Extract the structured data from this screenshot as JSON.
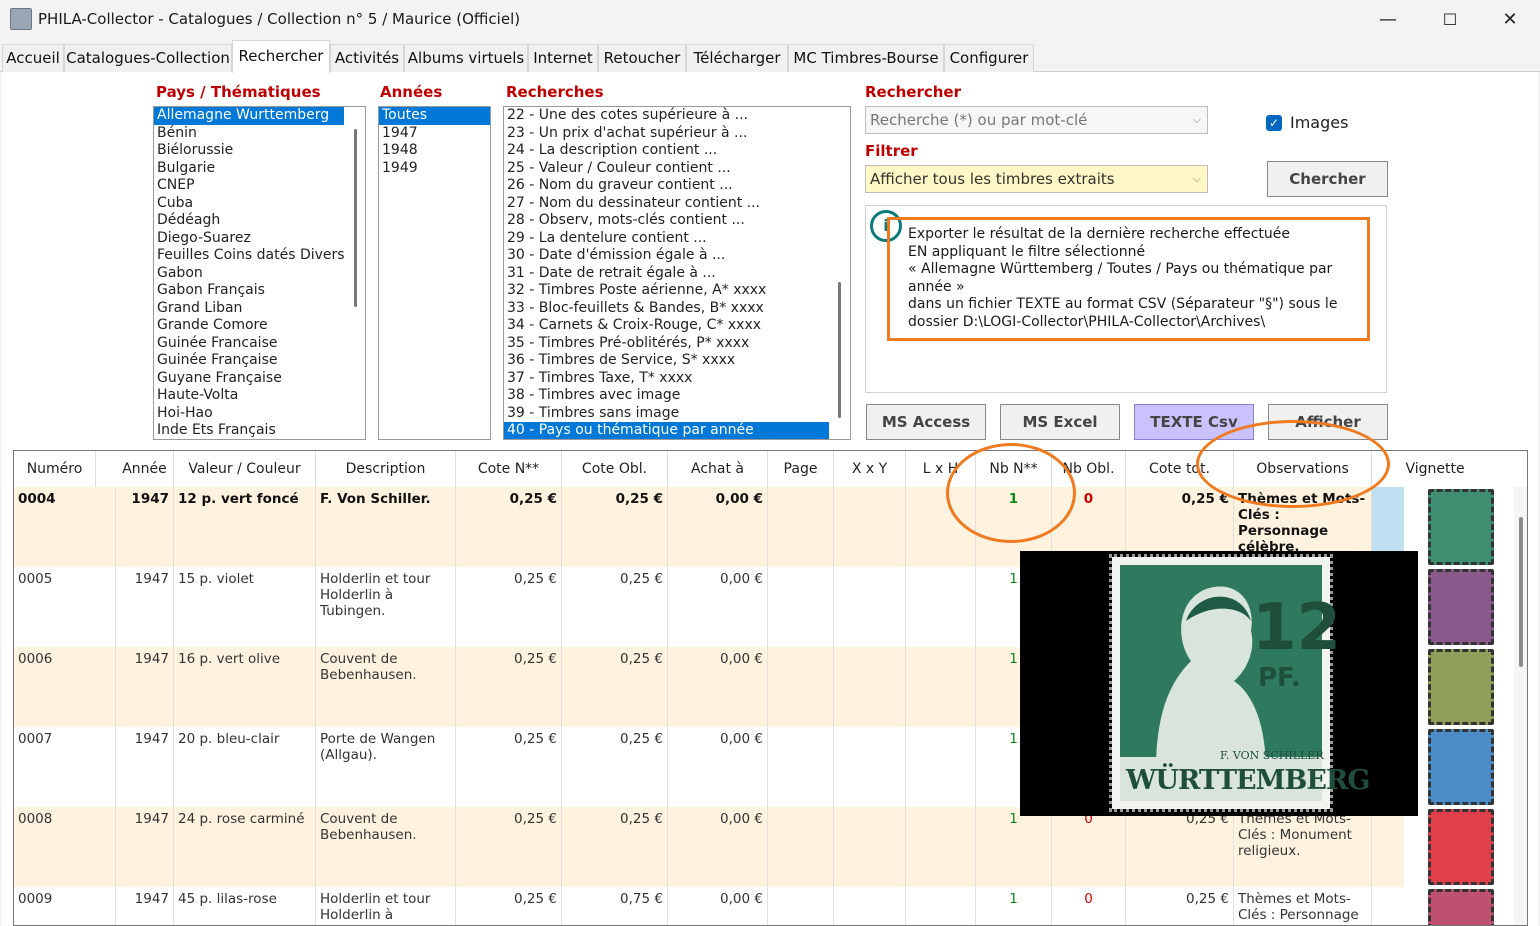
{
  "window": {
    "title": "PHILA-Collector - Catalogues / Collection n° 5 / Maurice (Officiel)",
    "minimize": "—",
    "maximize": "☐",
    "close": "✕"
  },
  "tabs": [
    "Accueil",
    "Catalogues-Collection",
    "Rechercher",
    "Activités",
    "Albums virtuels",
    "Internet",
    "Retoucher",
    "Télécharger",
    "MC Timbres-Bourse",
    "Configurer"
  ],
  "pays": {
    "label": "Pays / Thématiques",
    "items": [
      "Allemagne Wurttemberg",
      "Bénin",
      "Biélorussie",
      "Bulgarie",
      "CNEP",
      "Cuba",
      "Dédéagh",
      "Diego-Suarez",
      "Feuilles Coins datés Divers",
      "Gabon",
      "Gabon Français",
      "Grand Liban",
      "Grande Comore",
      "Guinée Francaise",
      "Guinée Française",
      "Guyane Française",
      "Haute-Volta",
      "Hoi-Hao",
      "Inde Ets Français"
    ]
  },
  "annees": {
    "label": "Années",
    "items": [
      "Toutes",
      "1947",
      "1948",
      "1949"
    ]
  },
  "recherches": {
    "label": "Recherches",
    "items": [
      "22 - Une des cotes supérieure à ...",
      "23 - Un prix d'achat supérieur à ...",
      "24 - La description contient ...",
      "25 - Valeur / Couleur contient ...",
      "26 - Nom du graveur contient ...",
      "27 - Nom du dessinateur contient ...",
      "28 - Observ, mots-clés contient ...",
      "29 - La dentelure contient ...",
      "30 - Date d'émission égale à ...",
      "31 - Date de retrait égale à ...",
      "32 - Timbres Poste aérienne, A* xxxx",
      "33 - Bloc-feuillets & Bandes, B* xxxx",
      "34 - Carnets & Croix-Rouge, C* xxxx",
      "35 - Timbres Pré-oblitérés, P* xxxx",
      "36 - Timbres de Service, S* xxxx",
      "37 - Timbres Taxe, T* xxxx",
      "38 - Timbres avec image",
      "39 - Timbres sans image",
      "40 - Pays ou thématique par année"
    ]
  },
  "rechercher": {
    "label": "Rechercher",
    "placeholder": "Recherche (*) ou par mot-clé"
  },
  "filtrer": {
    "label": "Filtrer",
    "value": "Afficher tous les timbres extraits"
  },
  "images": {
    "label": "Images"
  },
  "chercher": "Chercher",
  "info": {
    "lines": [
      "Exporter le résultat de la dernière recherche effectuée",
      "EN appliquant le filtre sélectionné",
      "« Allemagne Württemberg / Toutes / Pays ou thématique par",
      "année »",
      "dans un fichier TEXTE au format CSV (Séparateur \"§\") sous le",
      "dossier D:\\LOGI-Collector\\PHILA-Collector\\Archives\\"
    ]
  },
  "buttons": {
    "access": "MS Access",
    "excel": "MS Excel",
    "csv": "TEXTE Csv",
    "afficher": "Afficher"
  },
  "columns": [
    "Numéro",
    "Année",
    "Valeur / Couleur",
    "Description",
    "Cote N**",
    "Cote Obl.",
    "Achat à",
    "Page",
    "X x Y",
    "L x H",
    "Nb N**",
    "Nb Obl.",
    "Cote tot.",
    "Observations",
    "Vignette"
  ],
  "rows": [
    {
      "num": "0004",
      "annee": "1947",
      "valeur": "12 p. vert foncé",
      "desc": "F. Von Schiller.",
      "coteN": "0,25 €",
      "coteO": "0,25 €",
      "achat": "0,00 €",
      "nbN": "1",
      "nbO": "0",
      "tot": "0,25 €",
      "obs": "Thèmes et Mots-Clés : Personnage célèbre."
    },
    {
      "num": "0005",
      "annee": "1947",
      "valeur": "15 p. violet",
      "desc": "Holderlin et tour Holderlin à Tubingen.",
      "coteN": "0,25 €",
      "coteO": "0,25 €",
      "achat": "0,00 €",
      "nbN": "1",
      "nbO": "",
      "tot": "",
      "obs": ""
    },
    {
      "num": "0006",
      "annee": "1947",
      "valeur": "16 p. vert olive",
      "desc": "Couvent de Bebenhausen.",
      "coteN": "0,25 €",
      "coteO": "0,25 €",
      "achat": "0,00 €",
      "nbN": "1",
      "nbO": "",
      "tot": "",
      "obs": ""
    },
    {
      "num": "0007",
      "annee": "1947",
      "valeur": "20 p. bleu-clair",
      "desc": "Porte de Wangen (Allgau).",
      "coteN": "0,25 €",
      "coteO": "0,25 €",
      "achat": "0,00 €",
      "nbN": "1",
      "nbO": "",
      "tot": "",
      "obs": ""
    },
    {
      "num": "0008",
      "annee": "1947",
      "valeur": "24 p. rose carminé",
      "desc": "Couvent de Bebenhausen.",
      "coteN": "0,25 €",
      "coteO": "0,25 €",
      "achat": "0,00 €",
      "nbN": "1",
      "nbO": "0",
      "tot": "0,25 €",
      "obs": "Thèmes et Mots-Clés : Monument religieux."
    },
    {
      "num": "0009",
      "annee": "1947",
      "valeur": "45 p. lilas-rose",
      "desc": "Holderlin et tour Holderlin à Tubingen.",
      "coteN": "0,25 €",
      "coteO": "0,75 €",
      "achat": "0,00 €",
      "nbN": "1",
      "nbO": "0",
      "tot": "0,25 €",
      "obs": "Thèmes et Mots-Clés : Personnage"
    }
  ],
  "stamp": {
    "value": "12",
    "unit": "PF.",
    "name": "F. VON SCHILLER",
    "country": "WÜRTTEMBERG"
  },
  "colors": {
    "accent": "#0078d7",
    "orange": "#f07a20",
    "red_label": "#c00000"
  }
}
